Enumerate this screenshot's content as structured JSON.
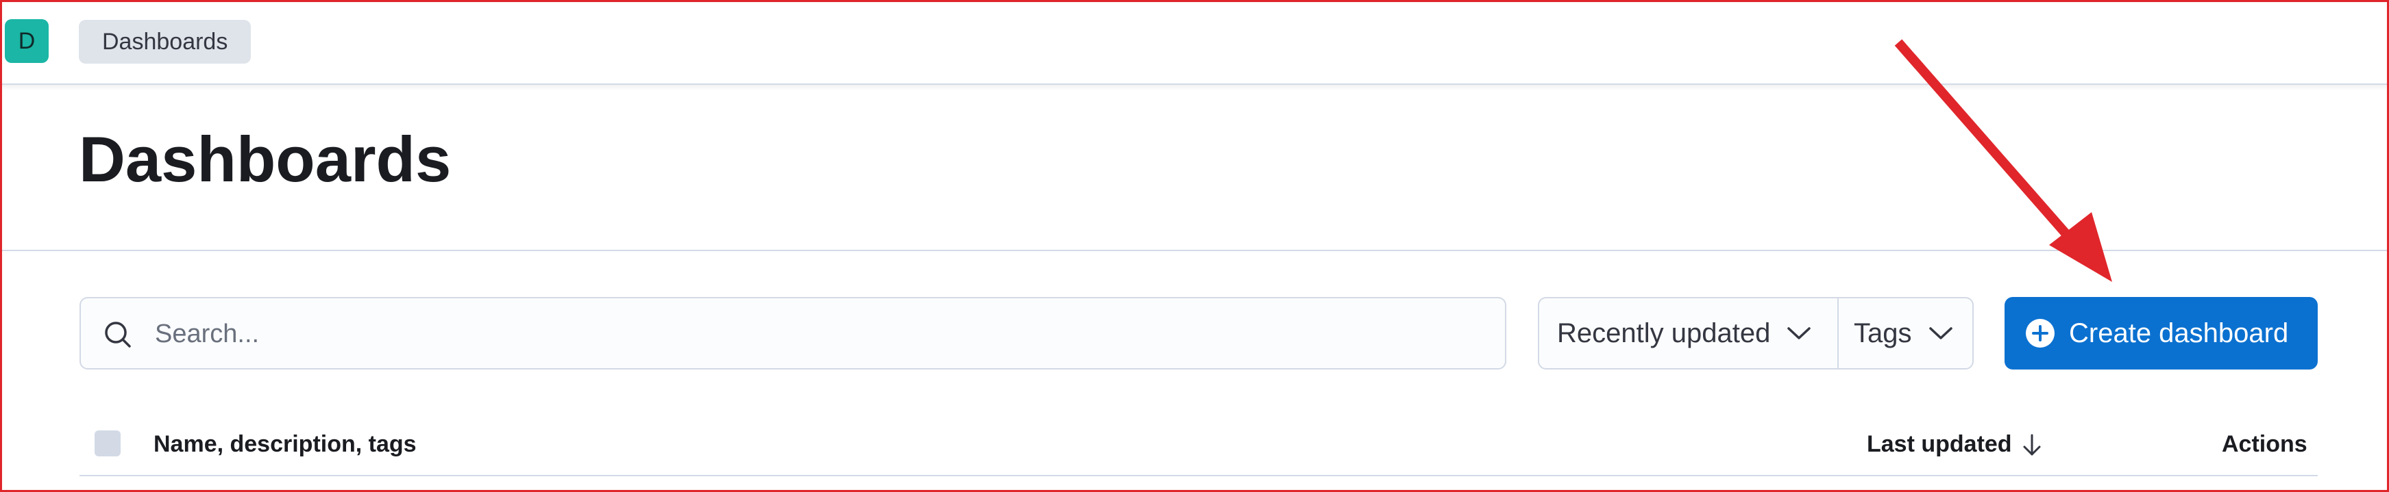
{
  "header": {
    "avatar_initial": "D",
    "breadcrumb": "Dashboards"
  },
  "page": {
    "title": "Dashboards"
  },
  "toolbar": {
    "search_placeholder": "Search...",
    "sort_label": "Recently updated",
    "tags_label": "Tags",
    "create_label": "Create dashboard"
  },
  "table": {
    "columns": {
      "name": "Name, description, tags",
      "last_updated": "Last updated",
      "actions": "Actions"
    }
  },
  "colors": {
    "accent": "#0b71d0",
    "avatar": "#1bb6a5",
    "annotation_arrow": "#e0262b",
    "frame": "#e0262b"
  },
  "icons": {
    "search": "search-icon",
    "chevron": "chevron-down-icon",
    "plus": "plus-circle-icon",
    "sort": "arrow-down-icon"
  }
}
